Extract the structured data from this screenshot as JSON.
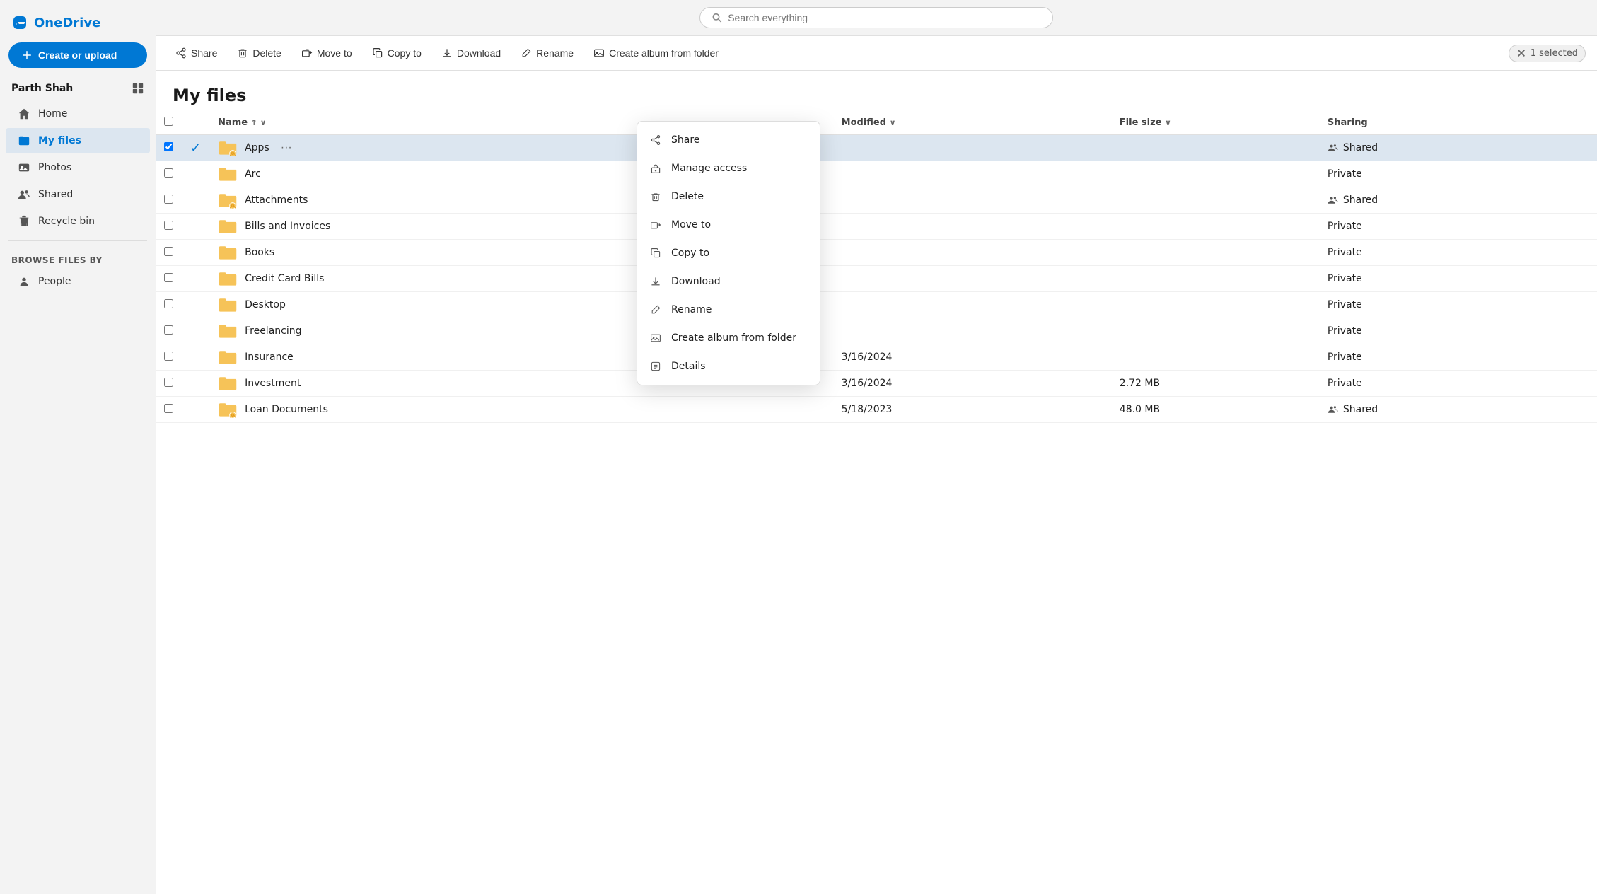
{
  "app": {
    "name": "OneDrive"
  },
  "search": {
    "placeholder": "Search everything"
  },
  "sidebar": {
    "user": "Parth Shah",
    "create_button": "Create or upload",
    "nav_items": [
      {
        "id": "home",
        "label": "Home",
        "icon": "home"
      },
      {
        "id": "my-files",
        "label": "My files",
        "icon": "folder",
        "active": true
      },
      {
        "id": "photos",
        "label": "Photos",
        "icon": "photos"
      },
      {
        "id": "shared",
        "label": "Shared",
        "icon": "shared"
      },
      {
        "id": "recycle-bin",
        "label": "Recycle bin",
        "icon": "trash"
      }
    ],
    "browse_section": "Browse files by",
    "browse_items": [
      {
        "id": "people",
        "label": "People",
        "icon": "people"
      }
    ]
  },
  "toolbar": {
    "share_label": "Share",
    "delete_label": "Delete",
    "move_to_label": "Move to",
    "copy_to_label": "Copy to",
    "download_label": "Download",
    "rename_label": "Rename",
    "create_album_label": "Create album from folder",
    "selected_text": "1 selected"
  },
  "page_title": "My files",
  "table": {
    "columns": [
      "Name",
      "Modified",
      "File size",
      "Sharing"
    ],
    "rows": [
      {
        "name": "Apps",
        "modified": "",
        "filesize": "",
        "sharing": "Shared",
        "selected": true,
        "icon_type": "folder-shared"
      },
      {
        "name": "Arc",
        "modified": "",
        "filesize": "",
        "sharing": "Private",
        "selected": false,
        "icon_type": "folder"
      },
      {
        "name": "Attachments",
        "modified": "",
        "filesize": "",
        "sharing": "Shared",
        "selected": false,
        "icon_type": "folder-shared"
      },
      {
        "name": "Bills and Invoices",
        "modified": "",
        "filesize": "",
        "sharing": "Private",
        "selected": false,
        "icon_type": "folder"
      },
      {
        "name": "Books",
        "modified": "",
        "filesize": "",
        "sharing": "Private",
        "selected": false,
        "icon_type": "folder"
      },
      {
        "name": "Credit Card Bills",
        "modified": "",
        "filesize": "",
        "sharing": "Private",
        "selected": false,
        "icon_type": "folder"
      },
      {
        "name": "Desktop",
        "modified": "",
        "filesize": "",
        "sharing": "Private",
        "selected": false,
        "icon_type": "folder"
      },
      {
        "name": "Freelancing",
        "modified": "",
        "filesize": "",
        "sharing": "Private",
        "selected": false,
        "icon_type": "folder"
      },
      {
        "name": "Insurance",
        "modified": "3/16/2024",
        "filesize": "",
        "sharing": "Private",
        "selected": false,
        "icon_type": "folder"
      },
      {
        "name": "Investment",
        "modified": "3/16/2024",
        "filesize": "2.72 MB",
        "sharing": "Private",
        "selected": false,
        "icon_type": "folder"
      },
      {
        "name": "Loan Documents",
        "modified": "5/18/2023",
        "filesize": "48.0 MB",
        "sharing": "Shared",
        "selected": false,
        "icon_type": "folder-shared"
      }
    ]
  },
  "context_menu": {
    "items": [
      {
        "id": "share",
        "label": "Share",
        "icon": "share"
      },
      {
        "id": "manage-access",
        "label": "Manage access",
        "icon": "manage-access"
      },
      {
        "id": "delete",
        "label": "Delete",
        "icon": "trash"
      },
      {
        "id": "move-to",
        "label": "Move to",
        "icon": "move"
      },
      {
        "id": "copy-to",
        "label": "Copy to",
        "icon": "copy"
      },
      {
        "id": "download",
        "label": "Download",
        "icon": "download"
      },
      {
        "id": "rename",
        "label": "Rename",
        "icon": "rename"
      },
      {
        "id": "create-album",
        "label": "Create album from folder",
        "icon": "album"
      },
      {
        "id": "details",
        "label": "Details",
        "icon": "details"
      }
    ]
  },
  "colors": {
    "accent": "#0078d4",
    "folder_yellow": "#f6c358",
    "folder_shared_badge": "#f6c358"
  }
}
